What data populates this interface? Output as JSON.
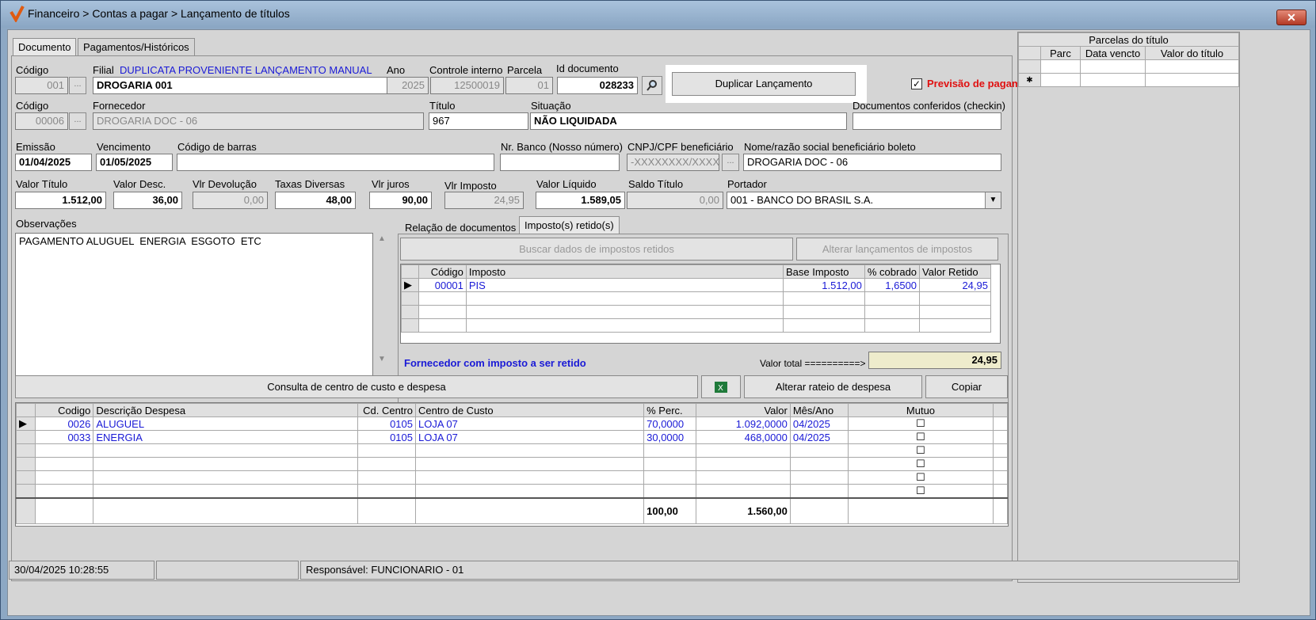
{
  "window": {
    "title": "Financeiro > Contas a pagar > Lançamento de títulos",
    "close": "✕"
  },
  "tabs": [
    "Documento",
    "Pagamentos/Históricos"
  ],
  "labels": {
    "codigo": "Código",
    "filial": "Filial",
    "ano": "Ano",
    "controle": "Controle interno",
    "parcela": "Parcela",
    "iddoc": "Id documento",
    "codigo2": "Código",
    "fornecedor": "Fornecedor",
    "titulo": "Título",
    "situacao": "Situação",
    "docconf": "Documentos conferidos (checkin)",
    "emissao": "Emissão",
    "vencimento": "Vencimento",
    "barras": "Código de barras",
    "nrbanco": "Nr. Banco (Nosso número)",
    "cnpj": "CNPJ/CPF beneficiário",
    "nome": "Nome/razão social beneficiário boleto",
    "valortit": "Valor Título",
    "valordesc": "Valor Desc.",
    "vlrdev": "Vlr Devolução",
    "taxas": "Taxas Diversas",
    "juros": "Vlr juros",
    "imposto": "Vlr Imposto",
    "liquido": "Valor Líquido",
    "saldo": "Saldo Título",
    "portador": "Portador",
    "obs": "Observações"
  },
  "filial_desc": "DUPLICATA PROVENIENTE LANÇAMENTO MANUAL",
  "values": {
    "codigo": "001",
    "filial": "DROGARIA 001",
    "ano": "2025",
    "controle": "12500019",
    "parcela": "01",
    "iddoc": "028233",
    "codigo2": "00006",
    "fornecedor": "DROGARIA DOC - 06",
    "titulo": "967",
    "situacao": "NÃO LIQUIDADA",
    "emissao": "01/04/2025",
    "vencimento": "01/05/2025",
    "cnpj": "-XXXXXXXX/XXXX-XX",
    "nome": "DROGARIA DOC - 06",
    "valortit": "1.512,00",
    "valordesc": "36,00",
    "vlrdev": "0,00",
    "taxas": "48,00",
    "juros": "90,00",
    "imposto": "24,95",
    "liquido": "1.589,05",
    "saldo": "0,00",
    "portador": "001 - BANCO DO BRASIL S.A.",
    "obs": "PAGAMENTO ALUGUEL  ENERGIA  ESGOTO  ETC"
  },
  "duplicar_button": "Duplicar Lançamento",
  "previsao": "Previsão de pagamento",
  "subtabs": [
    "Relação de documentos",
    "Imposto(s) retido(s)"
  ],
  "buscar_button": "Buscar dados de impostos retidos",
  "alterar_impostos_button": "Alterar lançamentos de impostos",
  "imposto_grid": {
    "headers": [
      "Código",
      "Imposto",
      "Base Imposto",
      "% cobrado",
      "Valor Retido"
    ],
    "rows": [
      [
        "00001",
        "PIS",
        "1.512,00",
        "1,6500",
        "24,95"
      ]
    ]
  },
  "fornecedor_msg": "Fornecedor com imposto a ser retido",
  "valor_total_label": "Valor total ==========>",
  "valor_total": "24,95",
  "consulta_button": "Consulta de centro de custo e despesa",
  "alterar_rateio_button": "Alterar rateio de despesa",
  "copiar_button": "Copiar",
  "despesa_grid": {
    "headers": [
      "Codigo",
      "Descrição Despesa",
      "Cd. Centro",
      "Centro de Custo",
      "% Perc.",
      "Valor",
      "Mês/Ano",
      "Mutuo"
    ],
    "rows": [
      [
        "0026",
        "ALUGUEL",
        "0105",
        "LOJA 07",
        "70,0000",
        "1.092,0000",
        "04/2025"
      ],
      [
        "0033",
        "ENERGIA",
        "0105",
        "LOJA 07",
        "30,0000",
        "468,0000",
        "04/2025"
      ]
    ],
    "total_perc": "100,00",
    "total_valor": "1.560,00"
  },
  "parcelas": {
    "title": "Parcelas do título",
    "headers": [
      "Parc",
      "Data vencto",
      "Valor do título"
    ]
  },
  "status": {
    "datetime": "30/04/2025 10:28:55",
    "responsavel": "Responsável: FUNCIONARIO - 01"
  }
}
